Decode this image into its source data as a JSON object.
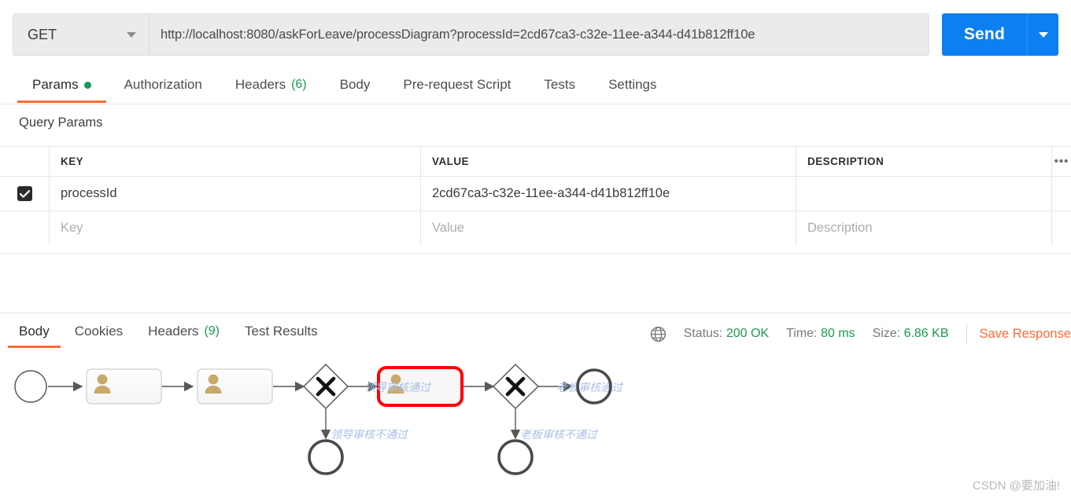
{
  "request": {
    "method": "GET",
    "method_caret_icon": "chevron-down-icon",
    "url": "http://localhost:8080/askForLeave/processDiagram?processId=2cd67ca3-c32e-11ee-a344-d41b812ff10e",
    "url_placeholder": "Enter request URL",
    "send_label": "Send",
    "send_caret_icon": "chevron-down-icon"
  },
  "request_tabs": [
    {
      "label": "Params",
      "badge": "",
      "dot": true,
      "active": true
    },
    {
      "label": "Authorization",
      "badge": "",
      "dot": false,
      "active": false
    },
    {
      "label": "Headers",
      "badge": "(6)",
      "dot": false,
      "active": false
    },
    {
      "label": "Body",
      "badge": "",
      "dot": false,
      "active": false
    },
    {
      "label": "Pre-request Script",
      "badge": "",
      "dot": false,
      "active": false
    },
    {
      "label": "Tests",
      "badge": "",
      "dot": false,
      "active": false
    },
    {
      "label": "Settings",
      "badge": "",
      "dot": false,
      "active": false
    }
  ],
  "query_params": {
    "title": "Query Params",
    "columns": [
      "KEY",
      "VALUE",
      "DESCRIPTION"
    ],
    "options_icon": "ellipsis-icon",
    "rows": [
      {
        "checked": true,
        "key": "processId",
        "value": "2cd67ca3-c32e-11ee-a344-d41b812ff10e",
        "description": ""
      }
    ],
    "empty_row": {
      "key_placeholder": "Key",
      "value_placeholder": "Value",
      "description_placeholder": "Description"
    }
  },
  "response_tabs": [
    {
      "label": "Body",
      "badge": "",
      "active": true
    },
    {
      "label": "Cookies",
      "badge": "",
      "active": false
    },
    {
      "label": "Headers",
      "badge": "(9)",
      "active": false
    },
    {
      "label": "Test Results",
      "badge": "",
      "active": false
    }
  ],
  "response_meta": {
    "globe_icon": "globe-icon",
    "status_label": "Status:",
    "status_value": "200 OK",
    "time_label": "Time:",
    "time_value": "80 ms",
    "size_label": "Size:",
    "size_value": "6.86 KB",
    "save_label": "Save Response",
    "accent_green": "#1a9b4c",
    "accent_orange": "#ff6c37"
  },
  "diagram": {
    "type": "bpmn-process-diagram",
    "highlight_color": "#ff0000",
    "user_icon_color": "#c9a96a",
    "label_color": "#a9c0e8",
    "nodes": [
      {
        "id": "start",
        "type": "start-event",
        "label": ""
      },
      {
        "id": "task1",
        "type": "user-task",
        "label": "",
        "highlighted": false
      },
      {
        "id": "task2",
        "type": "user-task",
        "label": "",
        "highlighted": false
      },
      {
        "id": "gateway1",
        "type": "exclusive-gateway",
        "label": ""
      },
      {
        "id": "task3",
        "type": "user-task",
        "label": "",
        "highlighted": true
      },
      {
        "id": "gateway2",
        "type": "exclusive-gateway",
        "label": ""
      },
      {
        "id": "end1",
        "type": "end-event",
        "label": ""
      },
      {
        "id": "end2",
        "type": "end-event",
        "label": ""
      },
      {
        "id": "end3",
        "type": "end-event",
        "label": ""
      }
    ],
    "flow_labels": [
      {
        "id": "flow-leader-pass",
        "text": "领导审核通过"
      },
      {
        "id": "flow-leader-reject",
        "text": "领导审核不通过"
      },
      {
        "id": "flow-boss-pass",
        "text": "老板审核通过"
      },
      {
        "id": "flow-boss-reject",
        "text": "老板审核不通过"
      }
    ]
  },
  "watermark": "CSDN @要加油!"
}
